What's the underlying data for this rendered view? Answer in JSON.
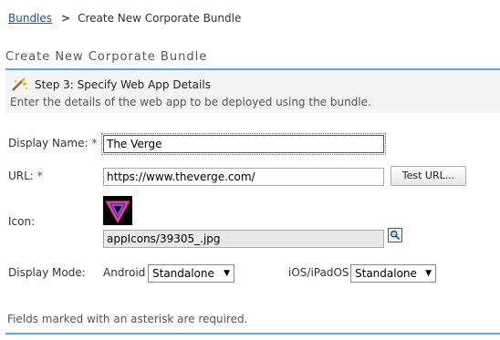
{
  "breadcrumb": {
    "link": "Bundles",
    "separator": ">",
    "current": "Create New Corporate Bundle"
  },
  "section_title": "Create New Corporate Bundle",
  "step": {
    "icon": "wizard-wand-icon",
    "title": "Step 3: Specify Web App Details",
    "description": "Enter the details of the web app to be deployed using the bundle."
  },
  "form": {
    "display_name": {
      "label": "Display Name:",
      "required_mark": "*",
      "value": "The Verge"
    },
    "url": {
      "label": "URL:",
      "required_mark": "*",
      "value": "https://www.theverge.com/",
      "test_button": "Test URL..."
    },
    "icon": {
      "label": "Icon:",
      "path": "appIcons/39305_.jpg",
      "browse_icon": "magnifier-icon"
    },
    "display_mode": {
      "label": "Display Mode:",
      "android": {
        "label": "Android",
        "value": "Standalone"
      },
      "ios": {
        "label": "iOS/iPadOS",
        "value": "Standalone"
      }
    }
  },
  "footnote": "Fields marked with an asterisk are required.",
  "colors": {
    "accent_rule": "#5aa9e0",
    "link": "#1a55a8"
  }
}
